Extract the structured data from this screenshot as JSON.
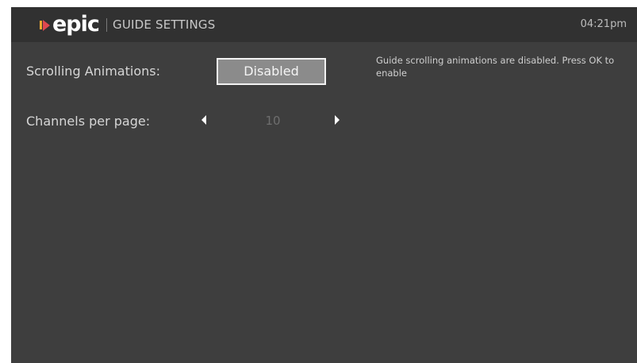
{
  "header": {
    "logo_text": "epic",
    "title": "GUIDE SETTINGS",
    "time": "04:21pm"
  },
  "settings": {
    "scrolling_animations": {
      "label": "Scrolling Animations:",
      "value": "Disabled",
      "help": "Guide scrolling animations are disabled. Press OK to enable"
    },
    "channels_per_page": {
      "label": "Channels per page:",
      "value": "10"
    }
  },
  "icons": {
    "decrease": "triangle-left-icon",
    "increase": "triangle-right-icon"
  },
  "colors": {
    "background": "#3e3e3e",
    "header_background": "#313131",
    "logo_orange": "#f0a830",
    "logo_red": "#e0484f",
    "button_fill": "#8b8b8b",
    "button_border": "#f2f2f2"
  }
}
